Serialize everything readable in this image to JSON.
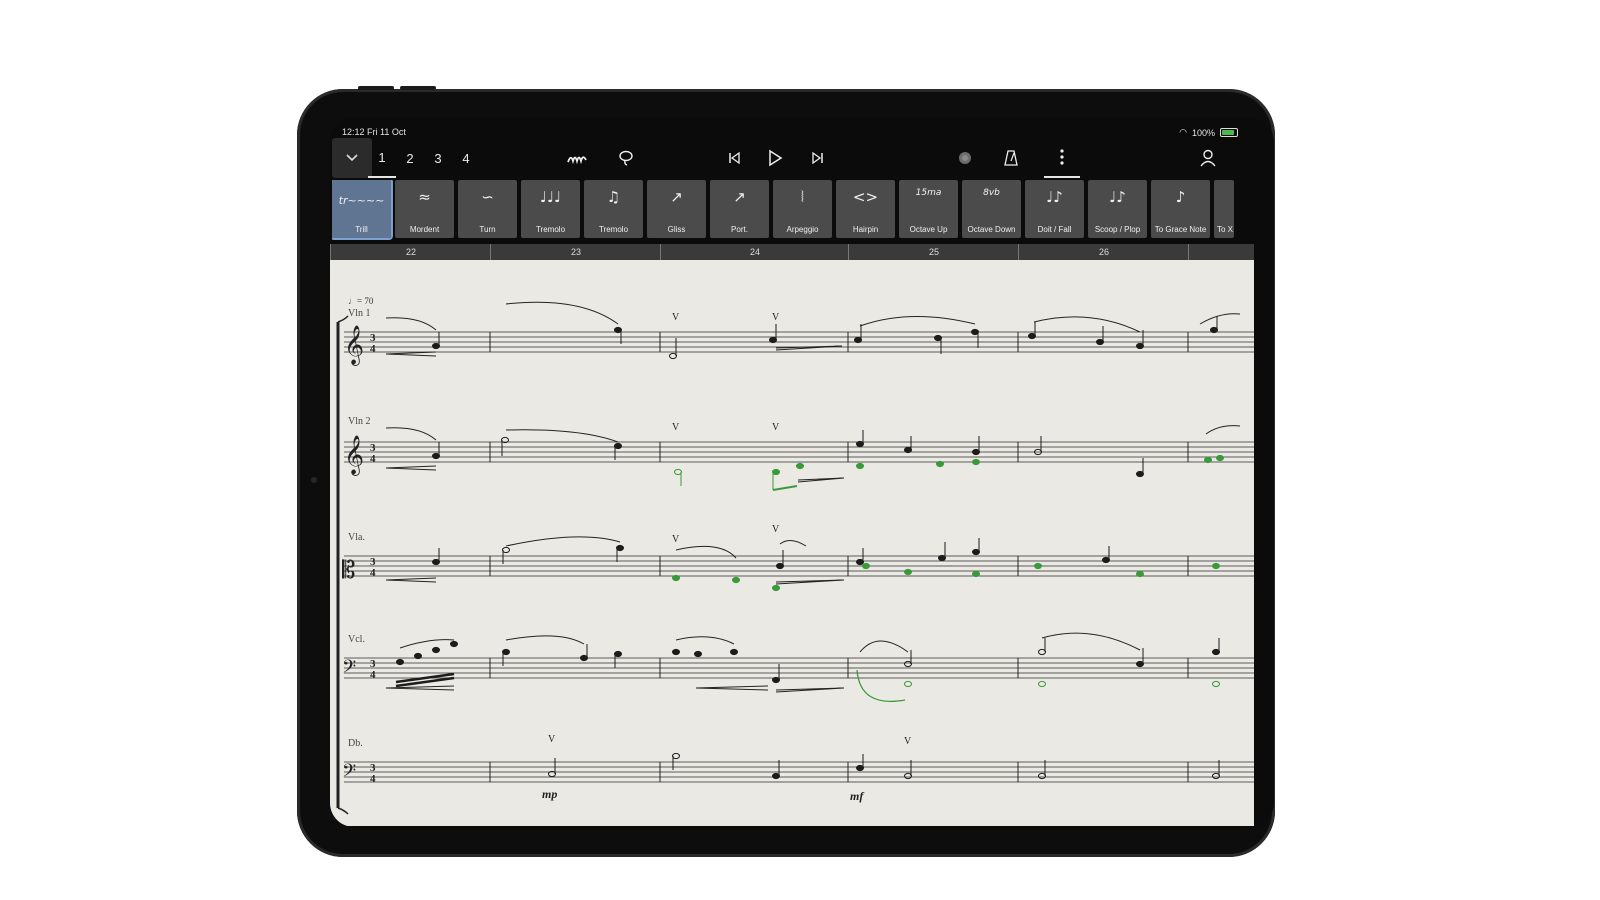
{
  "status": {
    "time": "12:12  Fri 11 Oct",
    "battery": "100%"
  },
  "toolbar": {
    "tabs": [
      "1",
      "2",
      "3",
      "4"
    ],
    "active_tab": "1",
    "icons": [
      "chevron-down-icon",
      "pen-icon",
      "lasso-icon",
      "skip-back-icon",
      "play-icon",
      "skip-forward-icon",
      "record-icon",
      "metronome-icon",
      "more-icon",
      "user-icon"
    ]
  },
  "palette": [
    {
      "label": "Trill",
      "glyph": "𝆖"
    },
    {
      "label": "Mordent",
      "glyph": "≈"
    },
    {
      "label": "Turn",
      "glyph": "∽"
    },
    {
      "label": "Tremolo",
      "glyph": "♩♩♩"
    },
    {
      "label": "Tremolo",
      "glyph": "♫"
    },
    {
      "label": "Gliss",
      "glyph": "↗"
    },
    {
      "label": "Port.",
      "glyph": "↗"
    },
    {
      "label": "Arpeggio",
      "glyph": "⦚"
    },
    {
      "label": "Hairpin",
      "glyph": "<>"
    },
    {
      "label": "Octave Up",
      "glyph": "15ma"
    },
    {
      "label": "Octave Down",
      "glyph": "8vb"
    },
    {
      "label": "Doit / Fall",
      "glyph": "♩♪"
    },
    {
      "label": "Scoop / Plop",
      "glyph": "♩♪"
    },
    {
      "label": "To Grace Note",
      "glyph": "♪"
    },
    {
      "label": "To X",
      "glyph": ""
    }
  ],
  "measures": [
    "22",
    "23",
    "24",
    "25",
    "26"
  ],
  "score": {
    "tempo": "♩= 70",
    "instruments": [
      "Vln 1",
      "Vln 2",
      "Vla.",
      "Vcl.",
      "Db."
    ],
    "time_signature": "3/4",
    "dynamics": [
      "mp",
      "mf"
    ]
  },
  "colors": {
    "selected_notes": "#3a9a3a",
    "paper": "#ebe9e3"
  }
}
